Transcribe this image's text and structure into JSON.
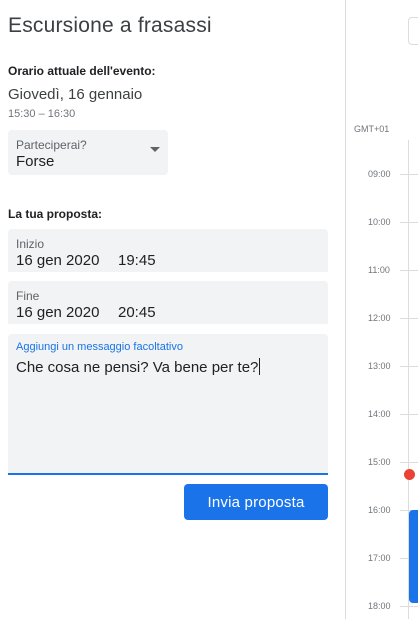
{
  "event": {
    "title": "Escursione a frasassi",
    "current_time_label": "Orario attuale dell'evento:",
    "date": "Giovedì, 16 gennaio",
    "time_range": "15:30 – 16:30"
  },
  "attendance": {
    "label": "Parteciperai?",
    "value": "Forse"
  },
  "proposal": {
    "label": "La tua proposta:",
    "start_label": "Inizio",
    "start_date": "16 gen 2020",
    "start_time": "19:45",
    "end_label": "Fine",
    "end_date": "16 gen 2020",
    "end_time": "20:45",
    "message_label": "Aggiungi un messaggio facoltativo",
    "message_value": "Che cosa ne pensi? Va bene per te?",
    "send_label": "Invia proposta"
  },
  "calendar": {
    "timezone": "GMT+01",
    "hours": [
      "09:00",
      "10:00",
      "11:00",
      "12:00",
      "13:00",
      "14:00",
      "15:00",
      "16:00",
      "17:00",
      "18:00"
    ]
  },
  "colors": {
    "accent": "#1a73e8",
    "now_indicator": "#ea4335",
    "field_bg": "#f1f3f4"
  }
}
